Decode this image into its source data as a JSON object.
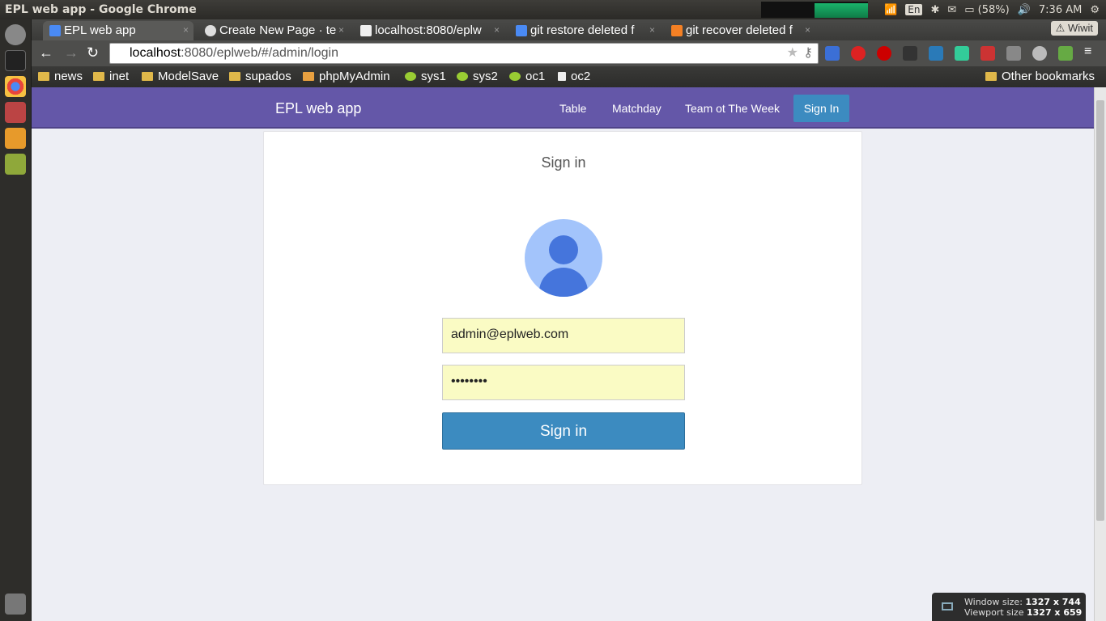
{
  "os": {
    "window_title": "EPL web app - Google Chrome",
    "battery": "(58%)",
    "time": "7:36 AM",
    "keyboard": "En"
  },
  "browser": {
    "tabs": [
      {
        "label": "EPL web app",
        "x": "×"
      },
      {
        "label": "Create New Page · te",
        "x": "×"
      },
      {
        "label": "localhost:8080/eplw",
        "x": "×"
      },
      {
        "label": "git restore deleted f",
        "x": "×"
      },
      {
        "label": "git recover deleted f",
        "x": "×"
      }
    ],
    "profile_label": "Wiwit",
    "url_host": "localhost",
    "url_rest": ":8080/eplweb/#/admin/login",
    "bookmarks": [
      "news",
      "inet",
      "ModelSave",
      "supados",
      "phpMyAdmin",
      "sys1",
      "sys2",
      "oc1",
      "oc2"
    ],
    "other_bookmarks": "Other bookmarks"
  },
  "app": {
    "brand": "EPL web app",
    "nav": {
      "table": "Table",
      "matchday": "Matchday",
      "totw": "Team ot The Week",
      "signin": "Sign In"
    },
    "login": {
      "title": "Sign in",
      "email": "admin@eplweb.com",
      "password": "••••••••",
      "button": "Sign in"
    }
  },
  "overlay": {
    "window_label": "Window size:",
    "window_value": "1327 x 744",
    "viewport_label": "Viewport size",
    "viewport_value": "1327 x 659"
  },
  "colors": {
    "navbar": "#6457a8",
    "accent": "#3c8bc0",
    "field_autofill": "#fafbc4"
  }
}
